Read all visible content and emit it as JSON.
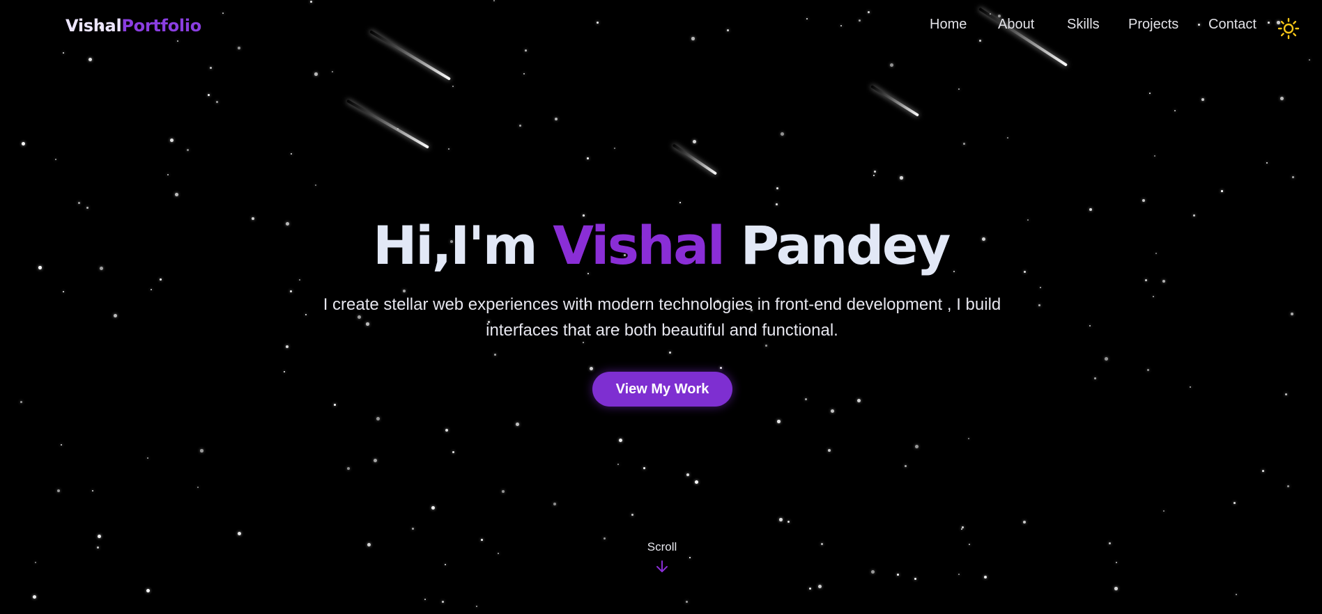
{
  "brand": {
    "logo_first": "Vishal",
    "logo_second": "Portfolio",
    "logo_first_color": "#ece5ff",
    "logo_second_color": "#8a3ee0"
  },
  "nav": {
    "items": [
      {
        "label": "Home"
      },
      {
        "label": "About"
      },
      {
        "label": "Skills"
      },
      {
        "label": "Projects"
      },
      {
        "label": "Contact"
      }
    ],
    "theme_toggle_icon": "sun-icon",
    "theme_toggle_color": "#f5c518"
  },
  "hero": {
    "greeting": "Hi,I'm",
    "first_name": "Vishal",
    "last_name": "Pandey",
    "subtitle": "I create stellar web experiences with modern technologies in front-end development , I build interfaces that are both beautiful and functional.",
    "cta_label": "View My Work",
    "accent_color": "#8a2ed6"
  },
  "scroll": {
    "label": "Scroll",
    "icon": "arrow-down-icon"
  },
  "background": {
    "color": "#000000",
    "decor": "starfield-with-meteors"
  }
}
